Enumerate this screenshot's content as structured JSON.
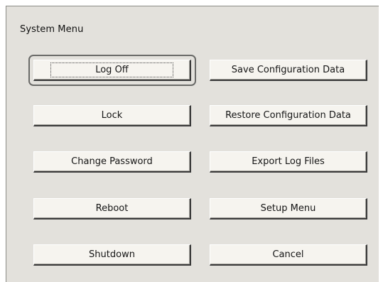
{
  "dialog": {
    "title": "System Menu"
  },
  "buttons": {
    "log_off": "Log Off",
    "lock": "Lock",
    "change_password": "Change Password",
    "reboot": "Reboot",
    "shutdown": "Shutdown",
    "save_config": "Save Configuration Data",
    "restore_config": "Restore Configuration Data",
    "export_logs": "Export Log Files",
    "setup_menu": "Setup Menu",
    "cancel": "Cancel"
  },
  "colors": {
    "panel_background": "#e3e1dc",
    "button_face": "#f6f4ef",
    "focus_ring": "#6a6a68"
  }
}
